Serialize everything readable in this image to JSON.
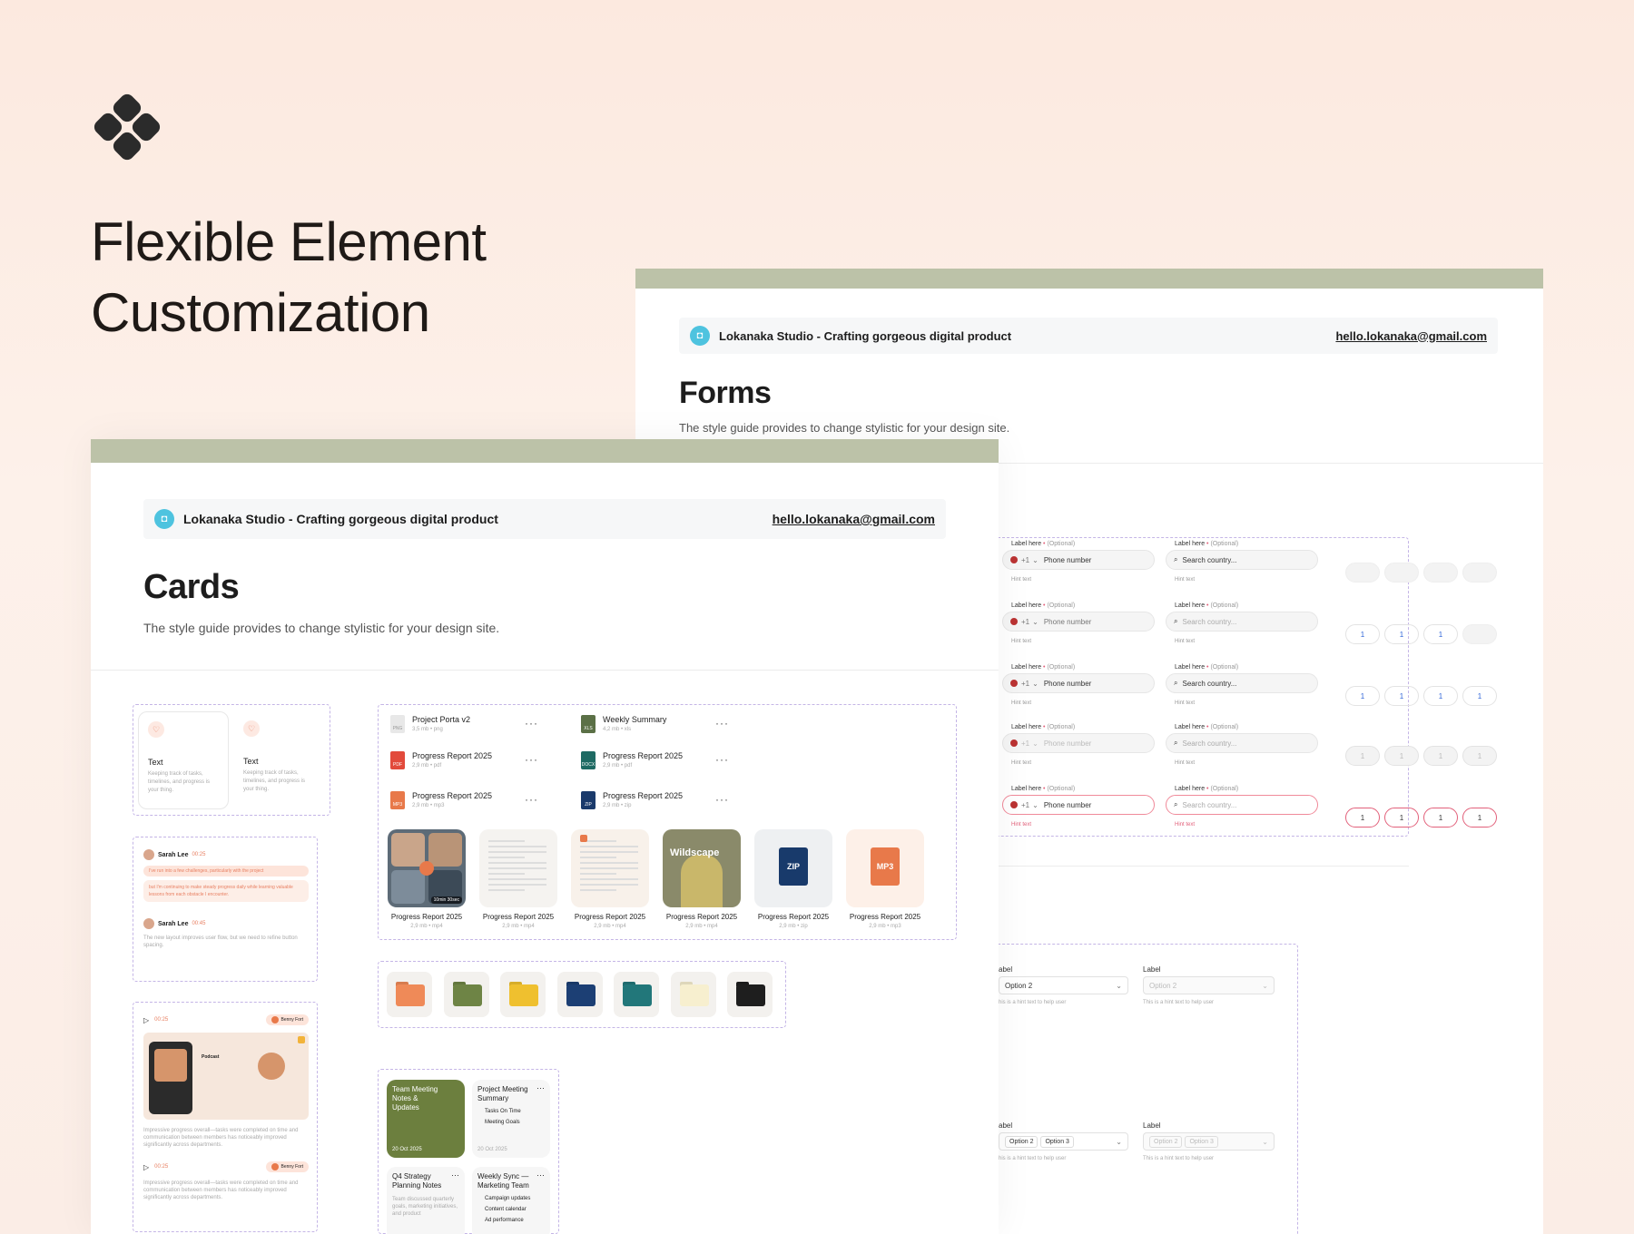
{
  "hero": {
    "title_line1": "Flexible Element",
    "title_line2": "Customization"
  },
  "header": {
    "brand": "Lokanaka Studio - Crafting gorgeous digital product",
    "email": "hello.lokanaka@gmail.com"
  },
  "forms": {
    "title": "Forms",
    "subtitle": "The style guide provides to change stylistic for your design site.",
    "label": "Label here",
    "optional": "(Optional)",
    "hint": "Hint text",
    "phone_prefix": "+1",
    "phone_placeholder": "Phone number",
    "search_placeholder": "Search country...",
    "otp_digit": "1",
    "select_label": "Label",
    "select_label_cut": "abel",
    "select_value": "Option 2",
    "select_hint": "This is a hint text to help user",
    "select_hint_cut": "his is a hint text to help user",
    "chip1": "Option 2",
    "chip2": "Option 3"
  },
  "cards": {
    "title": "Cards",
    "subtitle": "The style guide provides to change stylistic for your design site.",
    "feature_title": "Text",
    "feature_desc": "Keeping track of tasks, timelines, and progress is your thing.",
    "chat": {
      "name": "Sarah Lee",
      "time1": "00:25",
      "time2": "00:45",
      "msg1": "I've run into a few challenges, particularly with the project",
      "msg2": "but I'm continuing to make steady progress daily while learning valuable lessons from each obstacle I encounter.",
      "msg3": "The new layout improves user flow, but we need to refine button spacing."
    },
    "podcast": {
      "time": "00:25",
      "user": "Benny Fort",
      "title": "Podcast",
      "desc": "Impressive progress overall—tasks were completed on time and communication between members has noticeably improved significantly across departments."
    },
    "files": [
      {
        "name": "Project Porta v2",
        "size": "3,5 mb",
        "type": "png",
        "badge": "PNG",
        "color": "#e8e8e8"
      },
      {
        "name": "Weekly Summary",
        "size": "4,2 mb",
        "type": "xls",
        "badge": "XLS",
        "color": "#5b7046"
      },
      {
        "name": "Progress Report 2025",
        "size": "2,9 mb",
        "type": "pdf",
        "badge": "PDF",
        "color": "#e24a3b"
      },
      {
        "name": "Progress Report 2025",
        "size": "2,9 mb",
        "type": "pdf",
        "badge": "DOCX",
        "color": "#1e6a63"
      },
      {
        "name": "Progress Report 2025",
        "size": "2,9 mb",
        "type": "mp3",
        "badge": "MP3",
        "color": "#e8794a"
      },
      {
        "name": "Progress Report 2025",
        "size": "2,9 mb",
        "type": "zip",
        "badge": "ZIP",
        "color": "#1a3a6b"
      }
    ],
    "thumbs": [
      {
        "name": "Progress Report 2025",
        "size": "2,9 mb",
        "type": "mp4",
        "overlay": "10min 30sec"
      },
      {
        "name": "Progress Report 2025",
        "size": "2,9 mb",
        "type": "mp4",
        "overlay": ""
      },
      {
        "name": "Progress Report 2025",
        "size": "2,9 mb",
        "type": "mp4",
        "overlay": ""
      },
      {
        "name": "Progress Report 2025",
        "size": "2,9 mb",
        "type": "mp4",
        "overlay": "Wildscape"
      },
      {
        "name": "Progress Report 2025",
        "size": "2,9 mb",
        "type": "zip",
        "overlay": "ZIP"
      },
      {
        "name": "Progress Report 2025",
        "size": "2,9 mb",
        "type": "mp3",
        "overlay": "MP3"
      }
    ],
    "folder_colors": [
      "#ef8a58",
      "#6e8445",
      "#efc02f",
      "#1c3f74",
      "#22777a",
      "#f7efcf",
      "#1e1e1e"
    ],
    "notes": [
      {
        "title": "Team Meeting Notes & Updates",
        "date": "20 Oct 2025"
      },
      {
        "title": "Project Meeting Summary",
        "item1": "Tasks On Time",
        "item2": "Meeting Goals",
        "date": "20 Oct 2025"
      },
      {
        "title": "Q4 Strategy Planning Notes",
        "desc": "Team discussed quarterly goals, marketing initiatives, and product"
      },
      {
        "title": "Weekly Sync — Marketing Team",
        "item1": "Campaign updates",
        "item2": "Content calendar",
        "item3": "Ad performance"
      }
    ]
  }
}
